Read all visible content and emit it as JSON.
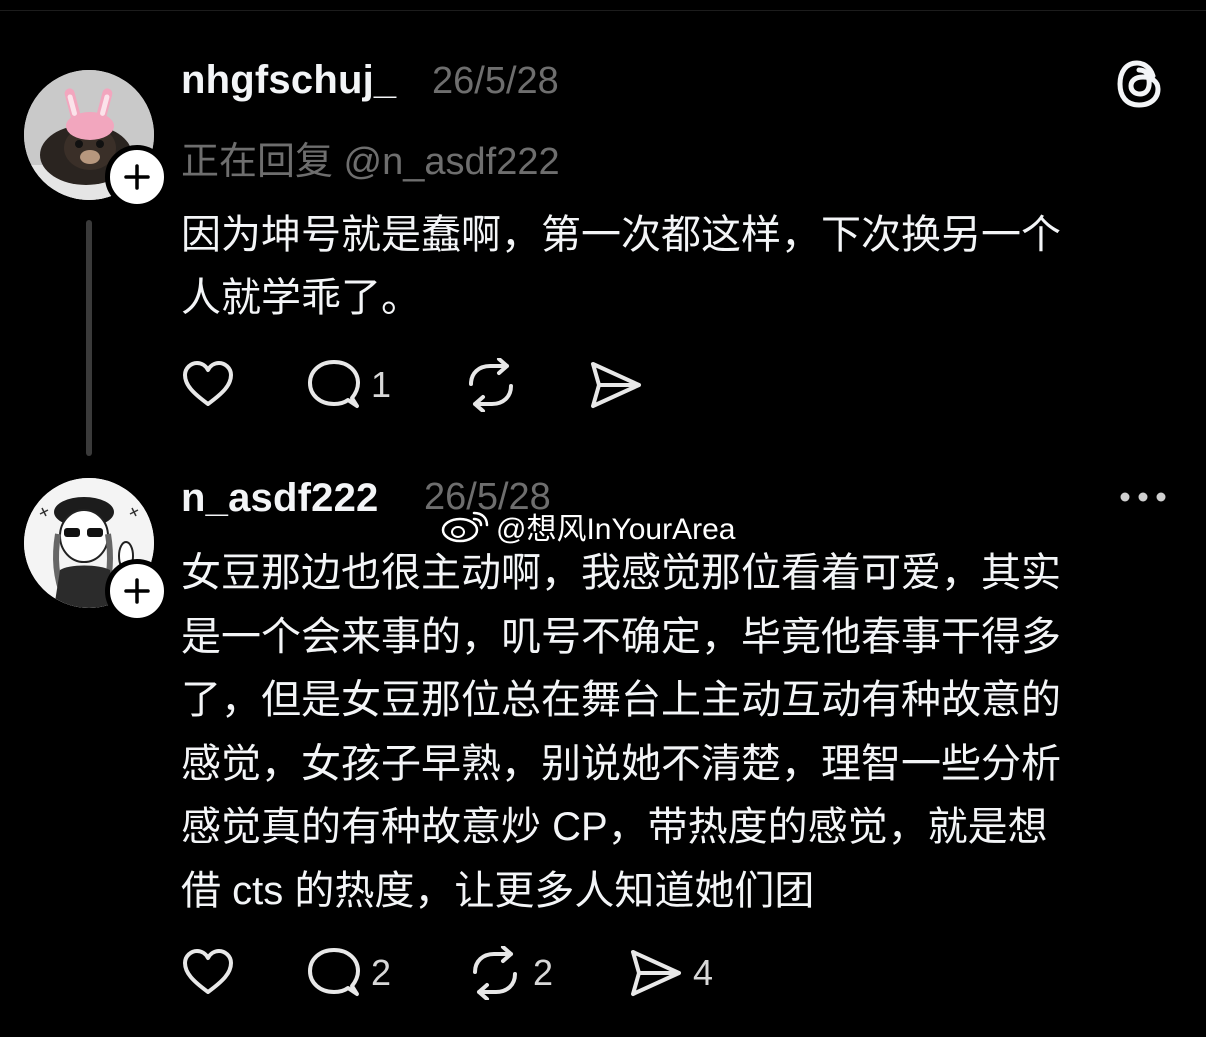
{
  "posts": [
    {
      "username": "nhgfschuj_",
      "date": "26/5/28",
      "reply_to": "正在回复 @n_asdf222",
      "text": "因为坤号就是蠢啊，第一次都这样，下次换另一个\n人就学乖了。",
      "actions": {
        "like": "",
        "comment": "1",
        "repost": "",
        "share": ""
      }
    },
    {
      "username": "n_asdf222",
      "date": "26/5/28",
      "text": "女豆那边也很主动啊，我感觉那位看着可爱，其实\n是一个会来事的，叽号不确定，毕竟他春事干得多\n了，但是女豆那位总在舞台上主动互动有种故意的\n感觉，女孩子早熟，别说她不清楚，理智一些分析\n感觉真的有种故意炒 CP，带热度的感觉，就是想\n借 cts 的热度，让更多人知道她们团",
      "actions": {
        "like": "",
        "comment": "2",
        "repost": "2",
        "share": "4"
      }
    }
  ],
  "watermark": "@想风InYourArea",
  "icons": {
    "app_logo": "threads-logo-icon",
    "more": "more-dots-icon",
    "like": "heart-icon",
    "comment": "comment-bubble-icon",
    "repost": "repost-icon",
    "share": "send-icon",
    "follow": "plus-icon",
    "watermark_logo": "weibo-icon"
  }
}
